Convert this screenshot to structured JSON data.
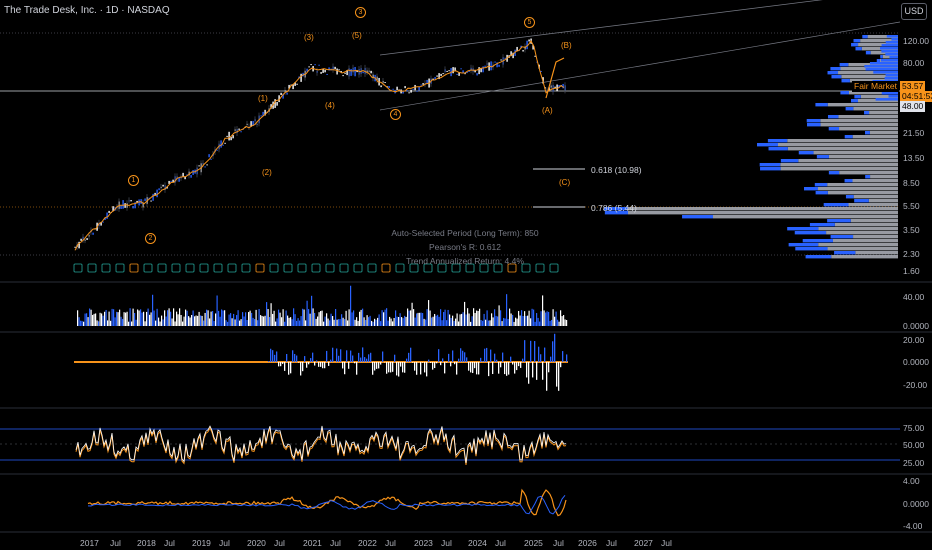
{
  "header": {
    "title": "The Trade Desk, Inc. · 1D · NASDAQ"
  },
  "currency_button": "USD",
  "price_axis": [
    "120.00",
    "80.00",
    "48.00",
    "21.50",
    "13.50",
    "8.50",
    "5.50",
    "3.50",
    "2.30",
    "1.60"
  ],
  "price_tags": {
    "current": "53.57",
    "countdown": "04:51:53",
    "fair_market": "Fair Market"
  },
  "fib_levels": [
    "0.618 (10.98)",
    "0.786 (5.44)"
  ],
  "annotations": {
    "period": "Auto-Selected Period (Long Term): 850",
    "pearson": "Pearson's R: 0.612",
    "trend": "Trend Annualized Return: 4.4%"
  },
  "wave_labels": [
    "1",
    "2",
    "(1)",
    "(2)",
    "(3)",
    "(4)",
    "3",
    "(5)",
    "4",
    "5",
    "(A)",
    "(B)",
    "(C)"
  ],
  "volume_axis": [
    "40.00",
    "0.0000"
  ],
  "osc1_axis": [
    "20.00",
    "0.0000",
    "-20.00"
  ],
  "rsi_axis": [
    "75.00",
    "50.00",
    "25.00"
  ],
  "osc3_axis": [
    "4.00",
    "0.0000",
    "-4.00"
  ],
  "time_axis": [
    "2017",
    "Jul",
    "2018",
    "Jul",
    "2019",
    "Jul",
    "2020",
    "Jul",
    "2021",
    "Jul",
    "2022",
    "Jul",
    "2023",
    "Jul",
    "2024",
    "Jul",
    "2025",
    "Jul",
    "2026",
    "Jul",
    "2027",
    "Jul"
  ],
  "colors": {
    "up": "#2962ff",
    "down": "#ffffff",
    "accent": "#f7931a",
    "pane_border": "#2a2e39"
  },
  "chart_data": {
    "type": "line",
    "title": "The Trade Desk, Inc. · 1D · NASDAQ",
    "xlabel": "",
    "ylabel": "",
    "scale": "log",
    "ylim": [
      1.6,
      140
    ],
    "x": [
      "2017-01",
      "2017-07",
      "2018-01",
      "2018-07",
      "2019-01",
      "2019-07",
      "2020-01",
      "2020-07",
      "2021-01",
      "2021-07",
      "2022-01",
      "2022-07",
      "2023-01",
      "2023-07",
      "2024-01",
      "2024-07",
      "2025-01",
      "2025-04",
      "2025-07"
    ],
    "series": [
      {
        "values": [
          2.4,
          5.5,
          5.8,
          8.5,
          11,
          20,
          26,
          44,
          75,
          70,
          70,
          48,
          52,
          70,
          70,
          85,
          125,
          48,
          53.57
        ]
      }
    ]
  }
}
